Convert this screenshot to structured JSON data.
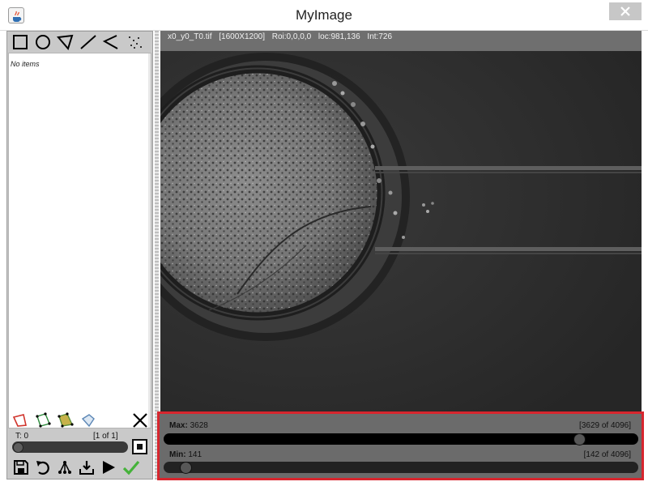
{
  "window": {
    "title": "MyImage",
    "close_icon": "close-icon",
    "app_icon": "java-cup-icon"
  },
  "shape_tools": [
    {
      "name": "rectangle-tool",
      "icon": "square-icon"
    },
    {
      "name": "ellipse-tool",
      "icon": "circle-icon"
    },
    {
      "name": "polygon-tool",
      "icon": "polygon-icon"
    },
    {
      "name": "line-tool",
      "icon": "line-icon"
    },
    {
      "name": "polyline-tool",
      "icon": "polyline-icon"
    },
    {
      "name": "point-tool",
      "icon": "points-icon"
    }
  ],
  "roi_list": {
    "empty_text": "No items"
  },
  "time": {
    "label": "T: 0",
    "count": "[1 of 1]",
    "value": 0
  },
  "image": {
    "filename": "x0_y0_T0.tif",
    "dimensions": "[1600X1200]",
    "roi": "Roi:0,0,0,0",
    "location": "loc:981,136",
    "intensity": "Int:726"
  },
  "contrast": {
    "max_label": "Max:",
    "max_value": "3628",
    "max_count": "[3629 of 4096]",
    "max_position": 3628,
    "min_label": "Min:",
    "min_value": "141",
    "min_count": "[142 of 4096]",
    "min_position": 141,
    "range": 4095,
    "highlight_color": "#d7262e"
  },
  "bottom_tools": [
    "red-roi-icon",
    "green-roi-icon",
    "yellow-roi-icon",
    "blue-roi-icon",
    "close-icon",
    "save-icon",
    "undo-icon",
    "tree-icon",
    "download-icon",
    "play-icon",
    "check-icon"
  ]
}
